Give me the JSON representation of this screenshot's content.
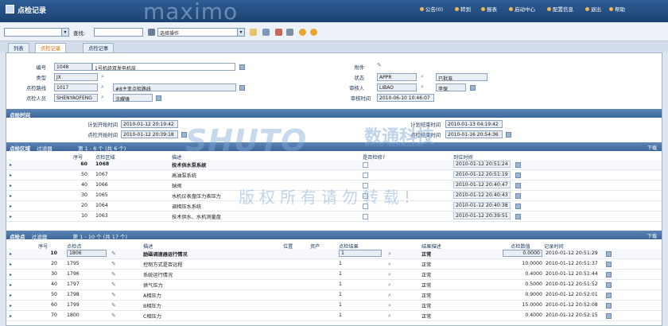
{
  "app": {
    "title": "点检记录",
    "brand": "maximo"
  },
  "topnav": [
    "公告(0)",
    "转到",
    "报表",
    "启动中心",
    "配置信息",
    "退出",
    "帮助"
  ],
  "toolbar": {
    "query_value": "",
    "find_label": "查找:",
    "find_value": "",
    "action_select": "选择操作"
  },
  "tabs": [
    "列表",
    "点检记录",
    "点检记事"
  ],
  "header": {
    "number_label": "编号",
    "number": "1048",
    "description": "1号机组双发电机层",
    "type_label": "类型",
    "type": "JX",
    "route_label": "点检路线",
    "route": "1017",
    "route_desc": "#8主变点检路线",
    "person_label": "点检人员",
    "person": "SHENYAOFENG",
    "person_name": "沈耀锋",
    "attach_label": "附件",
    "status_label": "状态",
    "status": "APPR",
    "status_desc": "已批准",
    "approver_label": "审核人",
    "approver": "LIBAO",
    "approver_name": "李保",
    "approve_time_label": "审核时间",
    "approve_time": "2010-06-10 10:46:07"
  },
  "time_section": {
    "title": "点检时间",
    "plan_start_label": "计划开始时间",
    "plan_start": "2010-01-12 20:19:42",
    "actual_start_label": "点检开始时间",
    "actual_start": "2010-01-12 20:39:18",
    "plan_end_label": "计划结束时间",
    "plan_end": "2010-01-13 04:19:42",
    "actual_end_label": "点检结束时间",
    "actual_end": "2010-01-16 20:54:36"
  },
  "area_section": {
    "title": "点检区域",
    "filter": "过滤器",
    "pager": "第 1 - 6 个 (共 6 个)",
    "download": "下载",
    "columns": [
      "序号",
      "点检区域",
      "描述",
      "是否检修?",
      "到位时间"
    ],
    "rows": [
      {
        "seq": "60",
        "code": "1068",
        "desc": "技术供水泵系统",
        "time": "2010-01-12 20:51:24"
      },
      {
        "seq": "50",
        "code": "1067",
        "desc": "高油泵系统",
        "time": "2010-01-12 20:51:19"
      },
      {
        "seq": "40",
        "code": "1066",
        "desc": "球阀",
        "time": "2010-01-12 20:40:47"
      },
      {
        "seq": "30",
        "code": "1065",
        "desc": "水机仪表盘压力表压力",
        "time": "2010-01-12 20:40:43"
      },
      {
        "seq": "20",
        "code": "1064",
        "desc": "调相压水系统",
        "time": "2010-01-12 20:40:38"
      },
      {
        "seq": "10",
        "code": "1063",
        "desc": "技术供水、水机测量盘",
        "time": "2010-01-12 20:39:51"
      }
    ]
  },
  "point_section": {
    "title": "点检点",
    "filter": "过滤器",
    "pager": "第 1 - 10 个 (共 17 个)",
    "download": "下载",
    "columns": [
      "序号",
      "点检点",
      "描述",
      "位置",
      "资产",
      "点检结果",
      "结果描述",
      "点检数值",
      "记录时间"
    ],
    "rows": [
      {
        "seq": "10",
        "code": "1806",
        "desc": "励磁调速器运行情况",
        "result": "1",
        "rdesc": "正常",
        "value": "0.0000",
        "time": "2010-01-12 20:51:29"
      },
      {
        "seq": "20",
        "code": "1795",
        "desc": "控制方式是否远程",
        "result": "1",
        "rdesc": "正常",
        "value": "10.0000",
        "time": "2010-01-12 20:51:37"
      },
      {
        "seq": "30",
        "code": "1796",
        "desc": "系统运行情况",
        "result": "1",
        "rdesc": "正常",
        "value": "0.4000",
        "time": "2010-01-12 20:51:44"
      },
      {
        "seq": "40",
        "code": "1797",
        "desc": "供气压力",
        "result": "1",
        "rdesc": "正常",
        "value": "0.5000",
        "time": "2010-01-12 20:51:52"
      },
      {
        "seq": "50",
        "code": "1798",
        "desc": "A相压力",
        "result": "1",
        "rdesc": "正常",
        "value": "0.9000",
        "time": "2010-01-12 20:52:01"
      },
      {
        "seq": "60",
        "code": "1799",
        "desc": "B相压力",
        "result": "1",
        "rdesc": "正常",
        "value": "15.0000",
        "time": "2010-01-12 20:52:08"
      },
      {
        "seq": "70",
        "code": "1800",
        "desc": "C相压力",
        "result": "1",
        "rdesc": "正常",
        "value": "0.4000",
        "time": "2010-01-12 20:52:15"
      }
    ]
  },
  "watermark": {
    "logo": "SHUTO",
    "cn": "数通科技",
    "en": "SHUTO TECHNOLOGY",
    "notice": "版权所有请勿转载!"
  }
}
